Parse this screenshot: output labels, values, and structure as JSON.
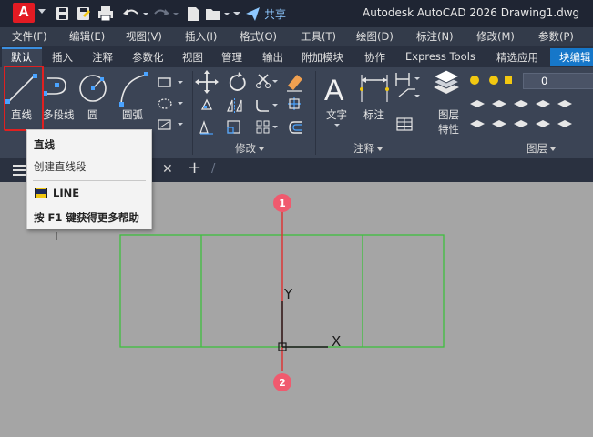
{
  "title_bar": {
    "app_logo": "A",
    "share_label": "共享",
    "app_title": "Autodesk AutoCAD 2026   Drawing1.dwg"
  },
  "menu": [
    "文件(F)",
    "编辑(E)",
    "视图(V)",
    "插入(I)",
    "格式(O)",
    "工具(T)",
    "绘图(D)",
    "标注(N)",
    "修改(M)",
    "参数(P)"
  ],
  "ribbon_tabs": [
    "默认",
    "插入",
    "注释",
    "参数化",
    "视图",
    "管理",
    "输出",
    "附加模块",
    "协作",
    "Express Tools",
    "精选应用",
    "块编辑"
  ],
  "draw_panel": {
    "line": "直线",
    "polyline": "多段线",
    "circle": "圆",
    "arc": "圆弧"
  },
  "modify_panel": {
    "label": "修改"
  },
  "annotation_panel": {
    "text": "文字",
    "dimension": "标注",
    "label": "注释"
  },
  "layers_panel": {
    "layer_properties_1": "图层",
    "layer_properties_2": "特性",
    "current_layer": "0",
    "label": "图层"
  },
  "tooltip": {
    "title": "直线",
    "description": "创建直线段",
    "command": "LINE",
    "help": "按 F1 键获得更多帮助"
  },
  "viewport": {
    "y_axis_label": "Y",
    "x_axis_label": "X",
    "marker_1": "1",
    "marker_2": "2"
  },
  "colors": {
    "rectangle_stroke": "#3fbf3f",
    "red_line": "#e03030",
    "marker_fill": "#f05a6e",
    "background": "#a5a5a5"
  }
}
